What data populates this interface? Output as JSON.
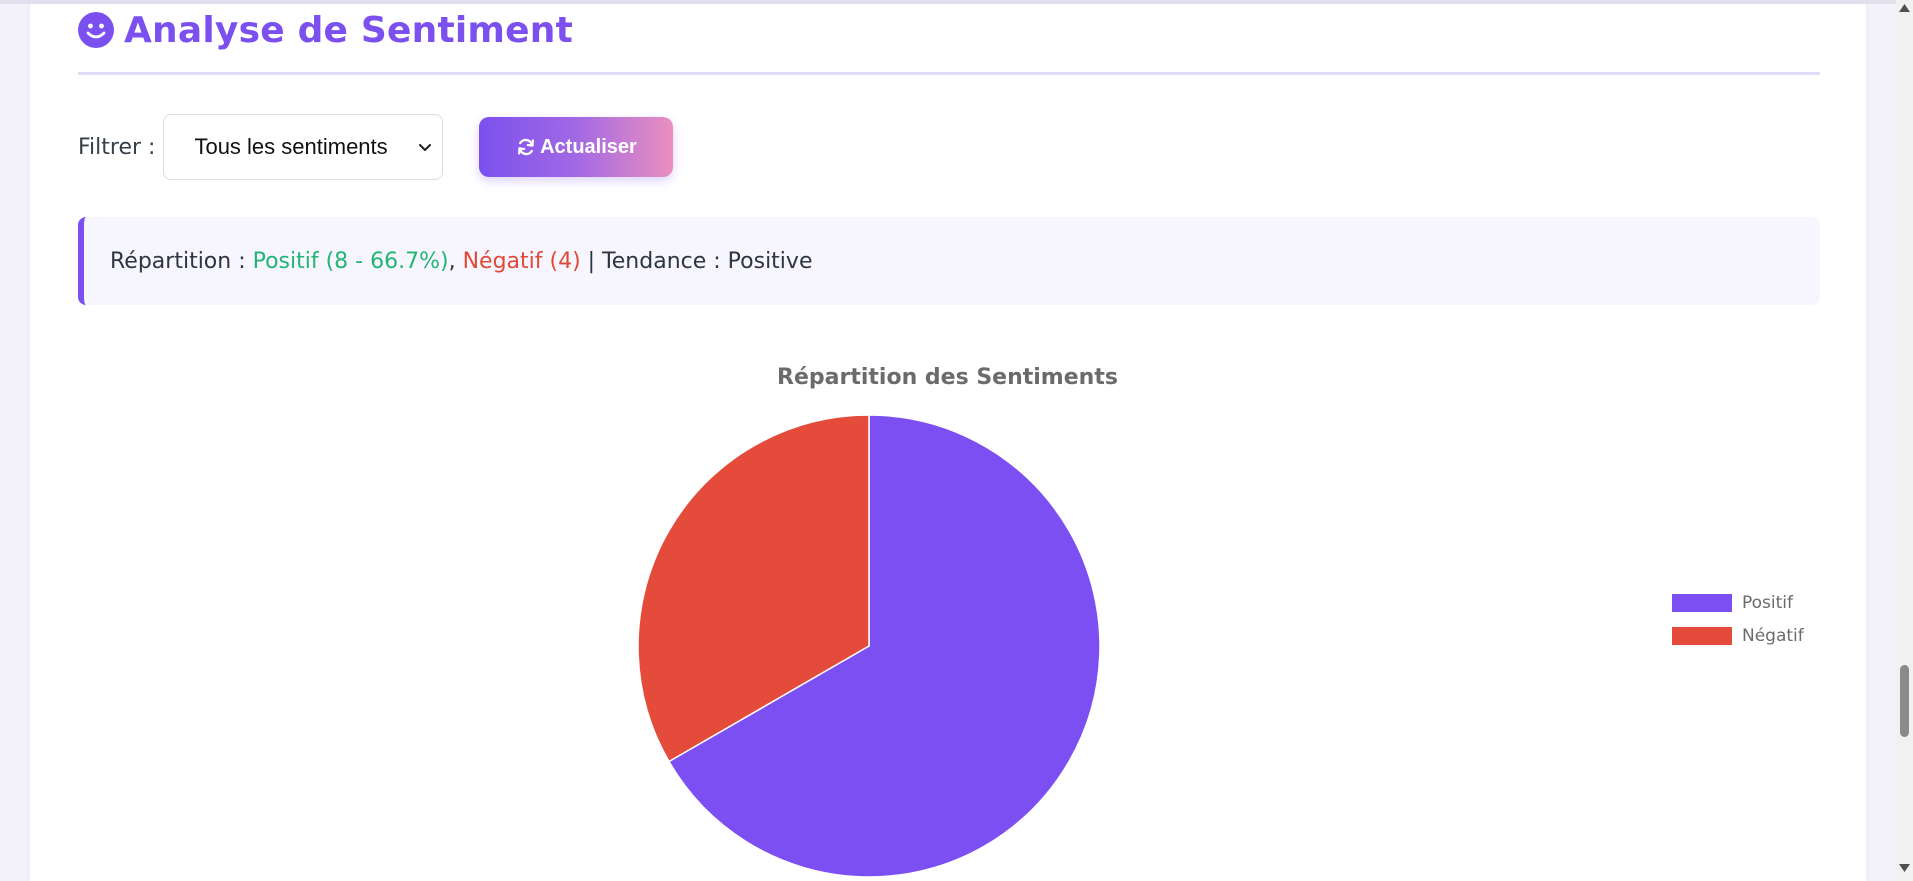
{
  "section": {
    "title": "Analyse de Sentiment",
    "icon": "smile-icon"
  },
  "filter": {
    "label": "Filtrer :",
    "selected": "Tous les sentiments"
  },
  "refresh_button": {
    "label": "Actualiser",
    "icon": "refresh-icon"
  },
  "summary": {
    "prefix": "Répartition : ",
    "positive": "Positif (8 - 66.7%)",
    "separator": ", ",
    "negative": "Négatif (4)",
    "suffix": " | Tendance : Positive"
  },
  "colors": {
    "accent": "#7b50ee",
    "positive_text": "#22b573",
    "negative": "#e04a38"
  },
  "chart_data": {
    "type": "pie",
    "title": "Répartition des Sentiments",
    "categories": [
      "Positif",
      "Négatif"
    ],
    "values": [
      8,
      4
    ],
    "colors": [
      "#7b4ff2",
      "#e54b3b"
    ],
    "legend_position": "right"
  }
}
